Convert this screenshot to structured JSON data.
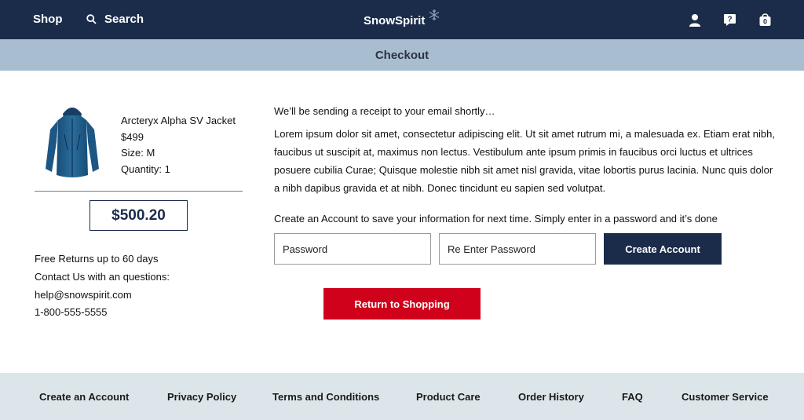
{
  "nav": {
    "shop_label": "Shop",
    "search_label": "Search",
    "brand": "SnowSpirit",
    "icons": [
      "user-icon",
      "help-icon",
      "cart-icon"
    ],
    "cart_count": "0"
  },
  "page_title": "Checkout",
  "product": {
    "name": "Arcteryx Alpha SV Jacket",
    "price": "$499",
    "size": "Size: M",
    "quantity": "Quantity: 1"
  },
  "total": "$500.20",
  "support": {
    "returns": "Free Returns up to 60 days",
    "contact": "Contact Us with an questions:",
    "email": "help@snowspirit.com",
    "phone": "1-800-555-5555"
  },
  "receipt_note": "We’ll be sending a receipt to your email shortly…",
  "body_text": "Lorem ipsum dolor sit amet, consectetur adipiscing elit. Ut sit amet rutrum mi, a malesuada ex. Etiam erat nibh, faucibus ut suscipit at, maximus non lectus. Vestibulum ante ipsum primis in faucibus orci luctus et ultrices posuere cubilia Curae; Quisque molestie nibh sit amet nisl gravida, vitae lobortis purus lacinia. Nunc quis dolor a nibh dapibus gravida et at nibh. Donec tincidunt eu sapien sed volutpat.",
  "account": {
    "note": "Create an Account to save your information for next time. Simply enter in a password and it’s done",
    "password_placeholder": "Password",
    "reenter_placeholder": "Re Enter Password",
    "create_label": "Create Account"
  },
  "return_label": "Return to Shopping",
  "footer": {
    "links": [
      "Create an Account",
      "Privacy Policy",
      "Terms and Conditions",
      "Product Care",
      "Order History",
      "FAQ",
      "Customer Service"
    ]
  },
  "colors": {
    "navy": "#1b2c4b",
    "band": "#a9bdd1",
    "red": "#d0021b",
    "footer": "#dce6ea"
  }
}
